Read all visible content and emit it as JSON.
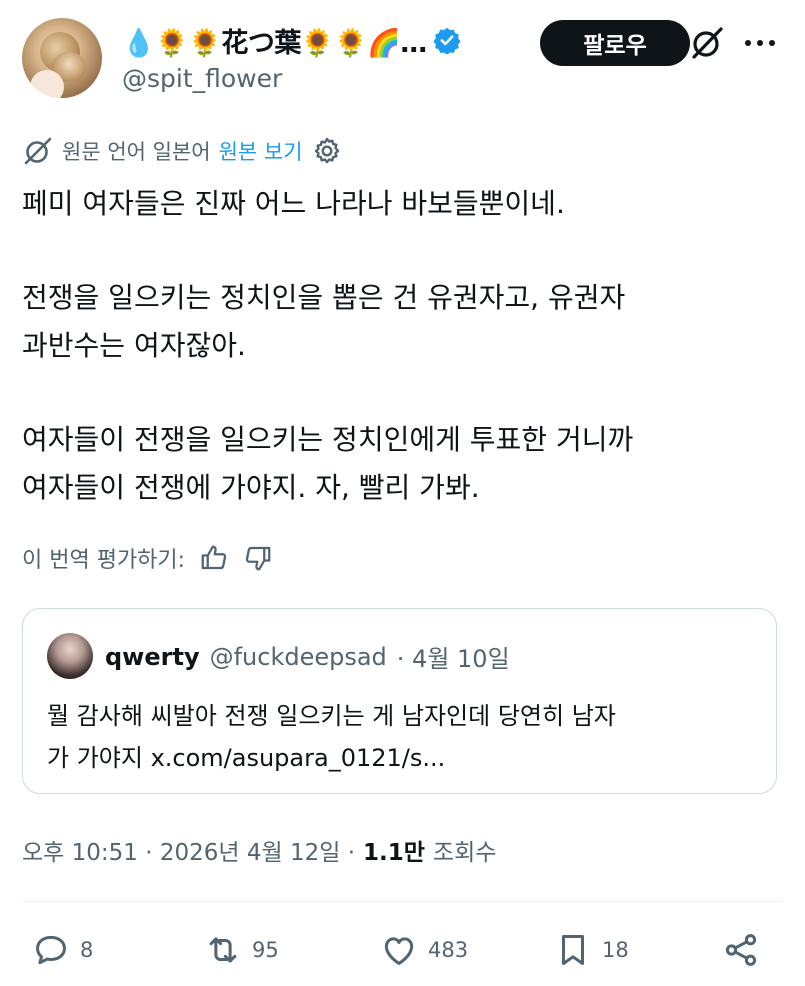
{
  "author": {
    "display_name": "💧🌻🌻花つ葉🌻🌻🌈…",
    "handle": "@spit_flower"
  },
  "follow_label": "팔로우",
  "translation": {
    "note": "원문 언어 일본어",
    "show_original": "원본 보기"
  },
  "tweet": {
    "paragraphs": [
      [
        "페미 여자들은 진짜 어느 나라나 바보들뿐이네."
      ],
      [
        "전쟁을 일으키는 정치인을 뽑은 건 유권자고, 유권자",
        "과반수는 여자잖아."
      ],
      [
        "여자들이 전쟁을 일으키는 정치인에게 투표한 거니까",
        "여자들이 전쟁에 가야지. 자, 빨리 가봐."
      ]
    ]
  },
  "rate_label": "이 번역 평가하기:",
  "quote": {
    "display_name": "qwerty",
    "handle": "@fuckdeepsad",
    "date": "· 4월 10일",
    "lines": [
      "뭘 감사해 씨발아 전쟁 일으키는 게 남자인데 당연히 남자",
      "가 가야지 x.com/asupara_0121/s..."
    ]
  },
  "meta": {
    "time": "오후 10:51 · 2026년 4월 12일 ·",
    "views": "1.1만",
    "views_label": "조회수"
  },
  "actions": {
    "replies": "8",
    "reposts": "95",
    "likes": "483",
    "bookmarks": "18"
  },
  "colors": {
    "text": "#0f1419",
    "secondary": "#536471",
    "link": "#1d9bf0",
    "verified": "#1d9bf0",
    "border": "#cfd9de"
  },
  "icons": [
    "verified-badge-icon",
    "grok-icon",
    "more-icon",
    "translate-icon",
    "settings-icon",
    "thumbs-up-icon",
    "thumbs-down-icon",
    "reply-icon",
    "repost-icon",
    "like-icon",
    "bookmark-icon",
    "share-icon"
  ]
}
